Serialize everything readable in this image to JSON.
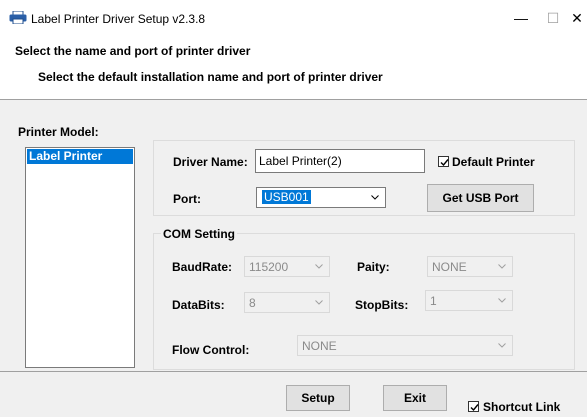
{
  "window": {
    "title": "Label Printer Driver Setup v2.3.8",
    "controls": {
      "minimize": "—",
      "maximize": "☐",
      "close": "✕"
    }
  },
  "header": {
    "title": "Select the name and port of printer driver",
    "subtitle": "Select the default installation name and port of printer driver"
  },
  "printer_model": {
    "label": "Printer Model:",
    "items": [
      "Label Printer"
    ],
    "selected": "Label Printer"
  },
  "driver": {
    "name_label": "Driver Name:",
    "name_value": "Label Printer(2)",
    "default_printer_label": "Default Printer",
    "default_printer_checked": true,
    "port_label": "Port:",
    "port_value": "USB001",
    "get_usb_port_button": "Get USB Port"
  },
  "com_setting": {
    "title": "COM Setting",
    "baudrate_label": "BaudRate:",
    "baudrate_value": "115200",
    "parity_label": "Paity:",
    "parity_value": "NONE",
    "databits_label": "DataBits:",
    "databits_value": "8",
    "stopbits_label": "StopBits:",
    "stopbits_value": "1",
    "flow_control_label": "Flow Control:",
    "flow_control_value": "NONE"
  },
  "footer": {
    "setup_button": "Setup",
    "exit_button": "Exit",
    "shortcut_link_label": "Shortcut Link",
    "shortcut_link_checked": true
  },
  "colors": {
    "selection": "#0078d7",
    "window_bg": "#f0f0f0",
    "disabled_text": "#8a8a8a"
  }
}
